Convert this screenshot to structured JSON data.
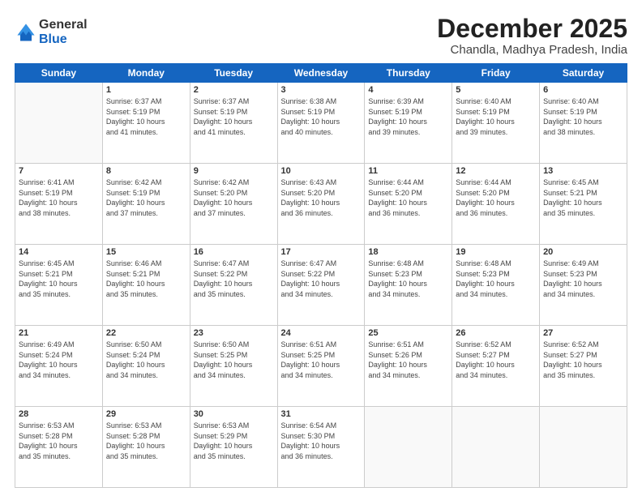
{
  "header": {
    "logo_general": "General",
    "logo_blue": "Blue",
    "month_title": "December 2025",
    "subtitle": "Chandla, Madhya Pradesh, India"
  },
  "weekdays": [
    "Sunday",
    "Monday",
    "Tuesday",
    "Wednesday",
    "Thursday",
    "Friday",
    "Saturday"
  ],
  "weeks": [
    [
      {
        "day": "",
        "info": ""
      },
      {
        "day": "1",
        "info": "Sunrise: 6:37 AM\nSunset: 5:19 PM\nDaylight: 10 hours\nand 41 minutes."
      },
      {
        "day": "2",
        "info": "Sunrise: 6:37 AM\nSunset: 5:19 PM\nDaylight: 10 hours\nand 41 minutes."
      },
      {
        "day": "3",
        "info": "Sunrise: 6:38 AM\nSunset: 5:19 PM\nDaylight: 10 hours\nand 40 minutes."
      },
      {
        "day": "4",
        "info": "Sunrise: 6:39 AM\nSunset: 5:19 PM\nDaylight: 10 hours\nand 39 minutes."
      },
      {
        "day": "5",
        "info": "Sunrise: 6:40 AM\nSunset: 5:19 PM\nDaylight: 10 hours\nand 39 minutes."
      },
      {
        "day": "6",
        "info": "Sunrise: 6:40 AM\nSunset: 5:19 PM\nDaylight: 10 hours\nand 38 minutes."
      }
    ],
    [
      {
        "day": "7",
        "info": "Sunrise: 6:41 AM\nSunset: 5:19 PM\nDaylight: 10 hours\nand 38 minutes."
      },
      {
        "day": "8",
        "info": "Sunrise: 6:42 AM\nSunset: 5:19 PM\nDaylight: 10 hours\nand 37 minutes."
      },
      {
        "day": "9",
        "info": "Sunrise: 6:42 AM\nSunset: 5:20 PM\nDaylight: 10 hours\nand 37 minutes."
      },
      {
        "day": "10",
        "info": "Sunrise: 6:43 AM\nSunset: 5:20 PM\nDaylight: 10 hours\nand 36 minutes."
      },
      {
        "day": "11",
        "info": "Sunrise: 6:44 AM\nSunset: 5:20 PM\nDaylight: 10 hours\nand 36 minutes."
      },
      {
        "day": "12",
        "info": "Sunrise: 6:44 AM\nSunset: 5:20 PM\nDaylight: 10 hours\nand 36 minutes."
      },
      {
        "day": "13",
        "info": "Sunrise: 6:45 AM\nSunset: 5:21 PM\nDaylight: 10 hours\nand 35 minutes."
      }
    ],
    [
      {
        "day": "14",
        "info": "Sunrise: 6:45 AM\nSunset: 5:21 PM\nDaylight: 10 hours\nand 35 minutes."
      },
      {
        "day": "15",
        "info": "Sunrise: 6:46 AM\nSunset: 5:21 PM\nDaylight: 10 hours\nand 35 minutes."
      },
      {
        "day": "16",
        "info": "Sunrise: 6:47 AM\nSunset: 5:22 PM\nDaylight: 10 hours\nand 35 minutes."
      },
      {
        "day": "17",
        "info": "Sunrise: 6:47 AM\nSunset: 5:22 PM\nDaylight: 10 hours\nand 34 minutes."
      },
      {
        "day": "18",
        "info": "Sunrise: 6:48 AM\nSunset: 5:23 PM\nDaylight: 10 hours\nand 34 minutes."
      },
      {
        "day": "19",
        "info": "Sunrise: 6:48 AM\nSunset: 5:23 PM\nDaylight: 10 hours\nand 34 minutes."
      },
      {
        "day": "20",
        "info": "Sunrise: 6:49 AM\nSunset: 5:23 PM\nDaylight: 10 hours\nand 34 minutes."
      }
    ],
    [
      {
        "day": "21",
        "info": "Sunrise: 6:49 AM\nSunset: 5:24 PM\nDaylight: 10 hours\nand 34 minutes."
      },
      {
        "day": "22",
        "info": "Sunrise: 6:50 AM\nSunset: 5:24 PM\nDaylight: 10 hours\nand 34 minutes."
      },
      {
        "day": "23",
        "info": "Sunrise: 6:50 AM\nSunset: 5:25 PM\nDaylight: 10 hours\nand 34 minutes."
      },
      {
        "day": "24",
        "info": "Sunrise: 6:51 AM\nSunset: 5:25 PM\nDaylight: 10 hours\nand 34 minutes."
      },
      {
        "day": "25",
        "info": "Sunrise: 6:51 AM\nSunset: 5:26 PM\nDaylight: 10 hours\nand 34 minutes."
      },
      {
        "day": "26",
        "info": "Sunrise: 6:52 AM\nSunset: 5:27 PM\nDaylight: 10 hours\nand 34 minutes."
      },
      {
        "day": "27",
        "info": "Sunrise: 6:52 AM\nSunset: 5:27 PM\nDaylight: 10 hours\nand 35 minutes."
      }
    ],
    [
      {
        "day": "28",
        "info": "Sunrise: 6:53 AM\nSunset: 5:28 PM\nDaylight: 10 hours\nand 35 minutes."
      },
      {
        "day": "29",
        "info": "Sunrise: 6:53 AM\nSunset: 5:28 PM\nDaylight: 10 hours\nand 35 minutes."
      },
      {
        "day": "30",
        "info": "Sunrise: 6:53 AM\nSunset: 5:29 PM\nDaylight: 10 hours\nand 35 minutes."
      },
      {
        "day": "31",
        "info": "Sunrise: 6:54 AM\nSunset: 5:30 PM\nDaylight: 10 hours\nand 36 minutes."
      },
      {
        "day": "",
        "info": ""
      },
      {
        "day": "",
        "info": ""
      },
      {
        "day": "",
        "info": ""
      }
    ]
  ]
}
